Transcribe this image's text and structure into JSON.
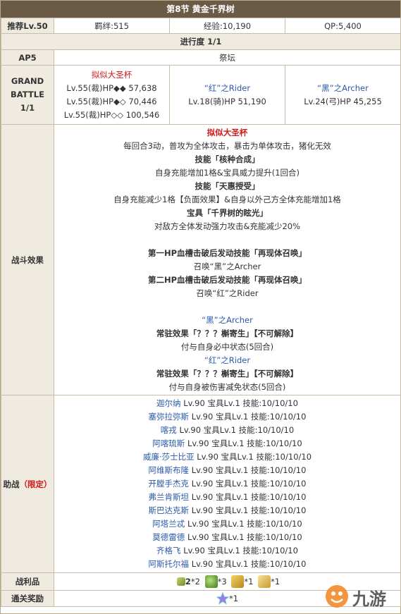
{
  "header": {
    "title": "第8节 黄金千界树"
  },
  "stats": {
    "recommend": "推荐Lv.50",
    "bond": "羁绊:515",
    "exp": "经验:10,190",
    "qp": "QP:5,400"
  },
  "progress": "进行度 1/1",
  "ap": {
    "label": "AP5",
    "place": "祭坛"
  },
  "battle": {
    "label_line1": "GRAND",
    "label_line2": "BATTLE",
    "label_line3": "1/1",
    "enemy1": {
      "name": "拟似大圣杯",
      "hp1": "Lv.55(裁)HP◆◆ 57,638",
      "hp2": "Lv.55(裁)HP◆◇ 70,446",
      "hp3": "Lv.55(裁)HP◇◇ 100,546"
    },
    "enemy2": {
      "name": "“红”之Rider",
      "hp": "Lv.18(骑)HP 51,190"
    },
    "enemy3": {
      "name": "“黑”之Archer",
      "hp": "Lv.24(弓)HP 45,255"
    }
  },
  "effects": {
    "label": "战斗效果",
    "lines": [
      {
        "t": "拟似大圣杯",
        "c": "red bold"
      },
      {
        "t": "每回合3动，普攻为全体攻击，暴击为单体攻击，猪化无效",
        "c": ""
      },
      {
        "t": "技能「核种合成」",
        "c": "bold"
      },
      {
        "t": "自身充能增加1格&宝具威力提升(1回合)",
        "c": ""
      },
      {
        "t": "技能「天惠授受」",
        "c": "bold"
      },
      {
        "t": "自身充能减少1格【负面效果】&自身以外己方全体充能增加1格",
        "c": ""
      },
      {
        "t": "宝具「千界树的眩光」",
        "c": "bold"
      },
      {
        "t": "对敌方全体发动强力攻击&充能减少20%",
        "c": ""
      },
      {
        "t": "",
        "c": ""
      },
      {
        "t": "第一HP血槽击破后发动技能「再现体召唤」",
        "c": "bold"
      },
      {
        "t": "召唤“黑”之Archer",
        "c": ""
      },
      {
        "t": "第二HP血槽击破后发动技能「再现体召唤」",
        "c": "bold"
      },
      {
        "t": "召唤“红”之Rider",
        "c": ""
      },
      {
        "t": "",
        "c": ""
      },
      {
        "t": "“黑”之Archer",
        "c": "blue"
      },
      {
        "t": "常驻效果「？？？槲寄生」【不可解除】",
        "c": "bold"
      },
      {
        "t": "付与自身必中状态(5回合)",
        "c": ""
      },
      {
        "t": "“红”之Rider",
        "c": "blue"
      },
      {
        "t": "常驻效果「？？？槲寄生」【不可解除】",
        "c": "bold"
      },
      {
        "t": "付与自身被伤害减免状态(5回合)",
        "c": ""
      }
    ]
  },
  "support": {
    "label": "助战",
    "label_limited": "（限定）",
    "rows": [
      {
        "name": "迦尔纳",
        "info": " Lv.90 宝具Lv.1 技能:10/10/10"
      },
      {
        "name": "塞弥拉弥斯",
        "info": " Lv.90 宝具Lv.1 技能:10/10/10"
      },
      {
        "name": "喀戎",
        "info": " Lv.90 宝具Lv.1 技能:10/10/10"
      },
      {
        "name": "阿喀琉斯",
        "info": " Lv.90 宝具Lv.1 技能:10/10/10"
      },
      {
        "name": "威廉·莎士比亚",
        "info": " Lv.90 宝具Lv.1 技能:10/10/10"
      },
      {
        "name": "阿维斯布隆",
        "info": " Lv.90 宝具Lv.1 技能:10/10/10"
      },
      {
        "name": "开膛手杰克",
        "info": " Lv.90 宝具Lv.1 技能:10/10/10"
      },
      {
        "name": "弗兰肯斯坦",
        "info": " Lv.90 宝具Lv.1 技能:10/10/10"
      },
      {
        "name": "斯巴达克斯",
        "info": " Lv.90 宝具Lv.1 技能:10/10/10"
      },
      {
        "name": "阿塔兰忒",
        "info": " Lv.90 宝具Lv.1 技能:10/10/10"
      },
      {
        "name": "莫德雷德",
        "info": " Lv.90 宝具Lv.1 技能:10/10/10"
      },
      {
        "name": "齐格飞",
        "info": " Lv.90 宝具Lv.1 技能:10/10/10"
      },
      {
        "name": "阿斯托尔福",
        "info": " Lv.90 宝具Lv.1 技能:10/10/10"
      }
    ]
  },
  "loot": {
    "label": "战利品",
    "items": [
      {
        "pre": "2",
        "count": "*2"
      },
      {
        "pre": "",
        "count": "*3"
      },
      {
        "pre": "",
        "count": "*1"
      },
      {
        "pre": "",
        "count": "*1"
      }
    ]
  },
  "clear": {
    "label": "通关奖励",
    "count": "*1"
  },
  "watermark": {
    "text": "九游"
  },
  "colors": {
    "header": "#6b5a46",
    "label_bg": "#f0ebe0",
    "red": "#d21919",
    "blue": "#2a59a8",
    "border": "#c7bda9"
  }
}
